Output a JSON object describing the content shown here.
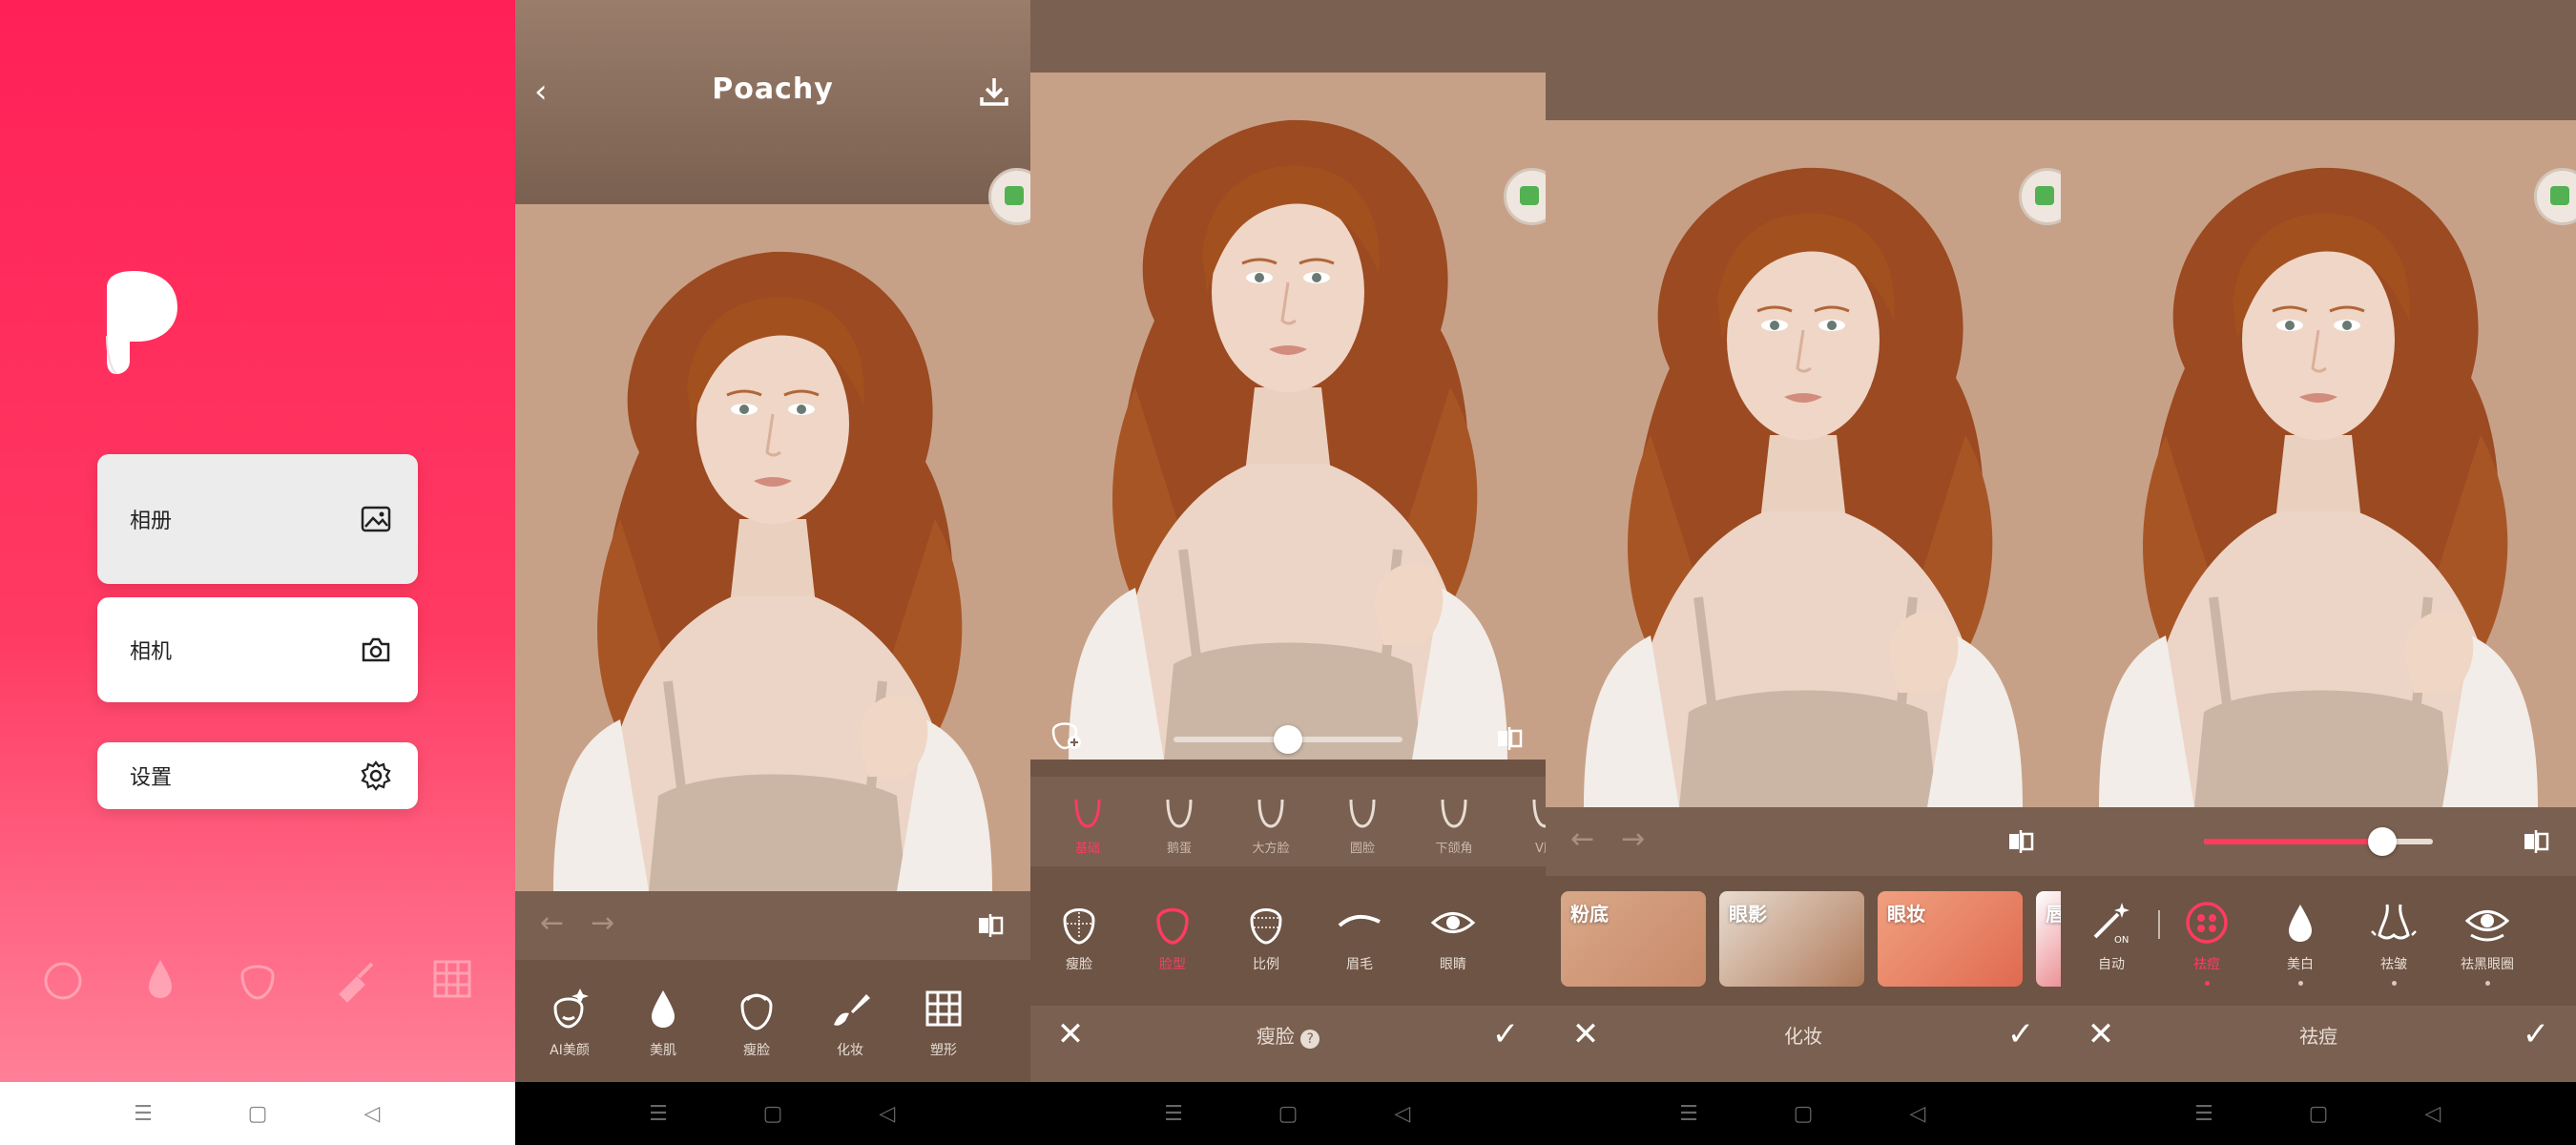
{
  "home": {
    "buttons": [
      {
        "label": "相册",
        "icon": "image-icon"
      },
      {
        "label": "相机",
        "icon": "camera-icon"
      },
      {
        "label": "设置",
        "icon": "gear-icon"
      }
    ]
  },
  "editor": {
    "title": "Poachy",
    "tools": [
      {
        "label": "AI美颜",
        "icon": "face-sparkle-icon"
      },
      {
        "label": "美肌",
        "icon": "drop-icon"
      },
      {
        "label": "瘦脸",
        "icon": "face-outline-icon"
      },
      {
        "label": "化妆",
        "icon": "brush-icon"
      },
      {
        "label": "塑形",
        "icon": "grid-icon"
      }
    ]
  },
  "face_slim": {
    "slider_value": 0.5,
    "shapes": [
      {
        "label": "基础",
        "active": true
      },
      {
        "label": "鹅蛋"
      },
      {
        "label": "大方脸"
      },
      {
        "label": "圆脸"
      },
      {
        "label": "下颌角"
      },
      {
        "label": "V脸"
      }
    ],
    "tools": [
      {
        "label": "瘦脸",
        "icon": "face-outline-icon"
      },
      {
        "label": "脸型",
        "icon": "face-red-icon",
        "active": true
      },
      {
        "label": "比例",
        "icon": "face-ratio-icon"
      },
      {
        "label": "眉毛",
        "icon": "eyebrow-icon"
      },
      {
        "label": "眼睛",
        "icon": "eye-icon"
      }
    ],
    "footer_title": "瘦脸"
  },
  "makeup": {
    "thumbs": [
      {
        "label": "粉底",
        "color_a": "#d8a888",
        "color_b": "#c88a6a"
      },
      {
        "label": "眼影",
        "color_a": "#e8dcd0",
        "color_b": "#b07a5a"
      },
      {
        "label": "眼妆",
        "color_a": "#f0a080",
        "color_b": "#e06a50"
      },
      {
        "label": "唇",
        "color_a": "#ffffff",
        "color_b": "#d8262f"
      }
    ],
    "footer_title": "化妆"
  },
  "beauty": {
    "slider_value": 0.78,
    "tools": [
      {
        "label": "自动",
        "icon": "magic-wand-icon"
      },
      {
        "label": "祛痘",
        "icon": "acne-icon",
        "active": true
      },
      {
        "label": "美白",
        "icon": "drop-icon"
      },
      {
        "label": "祛皱",
        "icon": "nose-icon"
      },
      {
        "label": "祛黑眼圈",
        "icon": "eye-icon"
      }
    ],
    "footer_title": "祛痘"
  }
}
